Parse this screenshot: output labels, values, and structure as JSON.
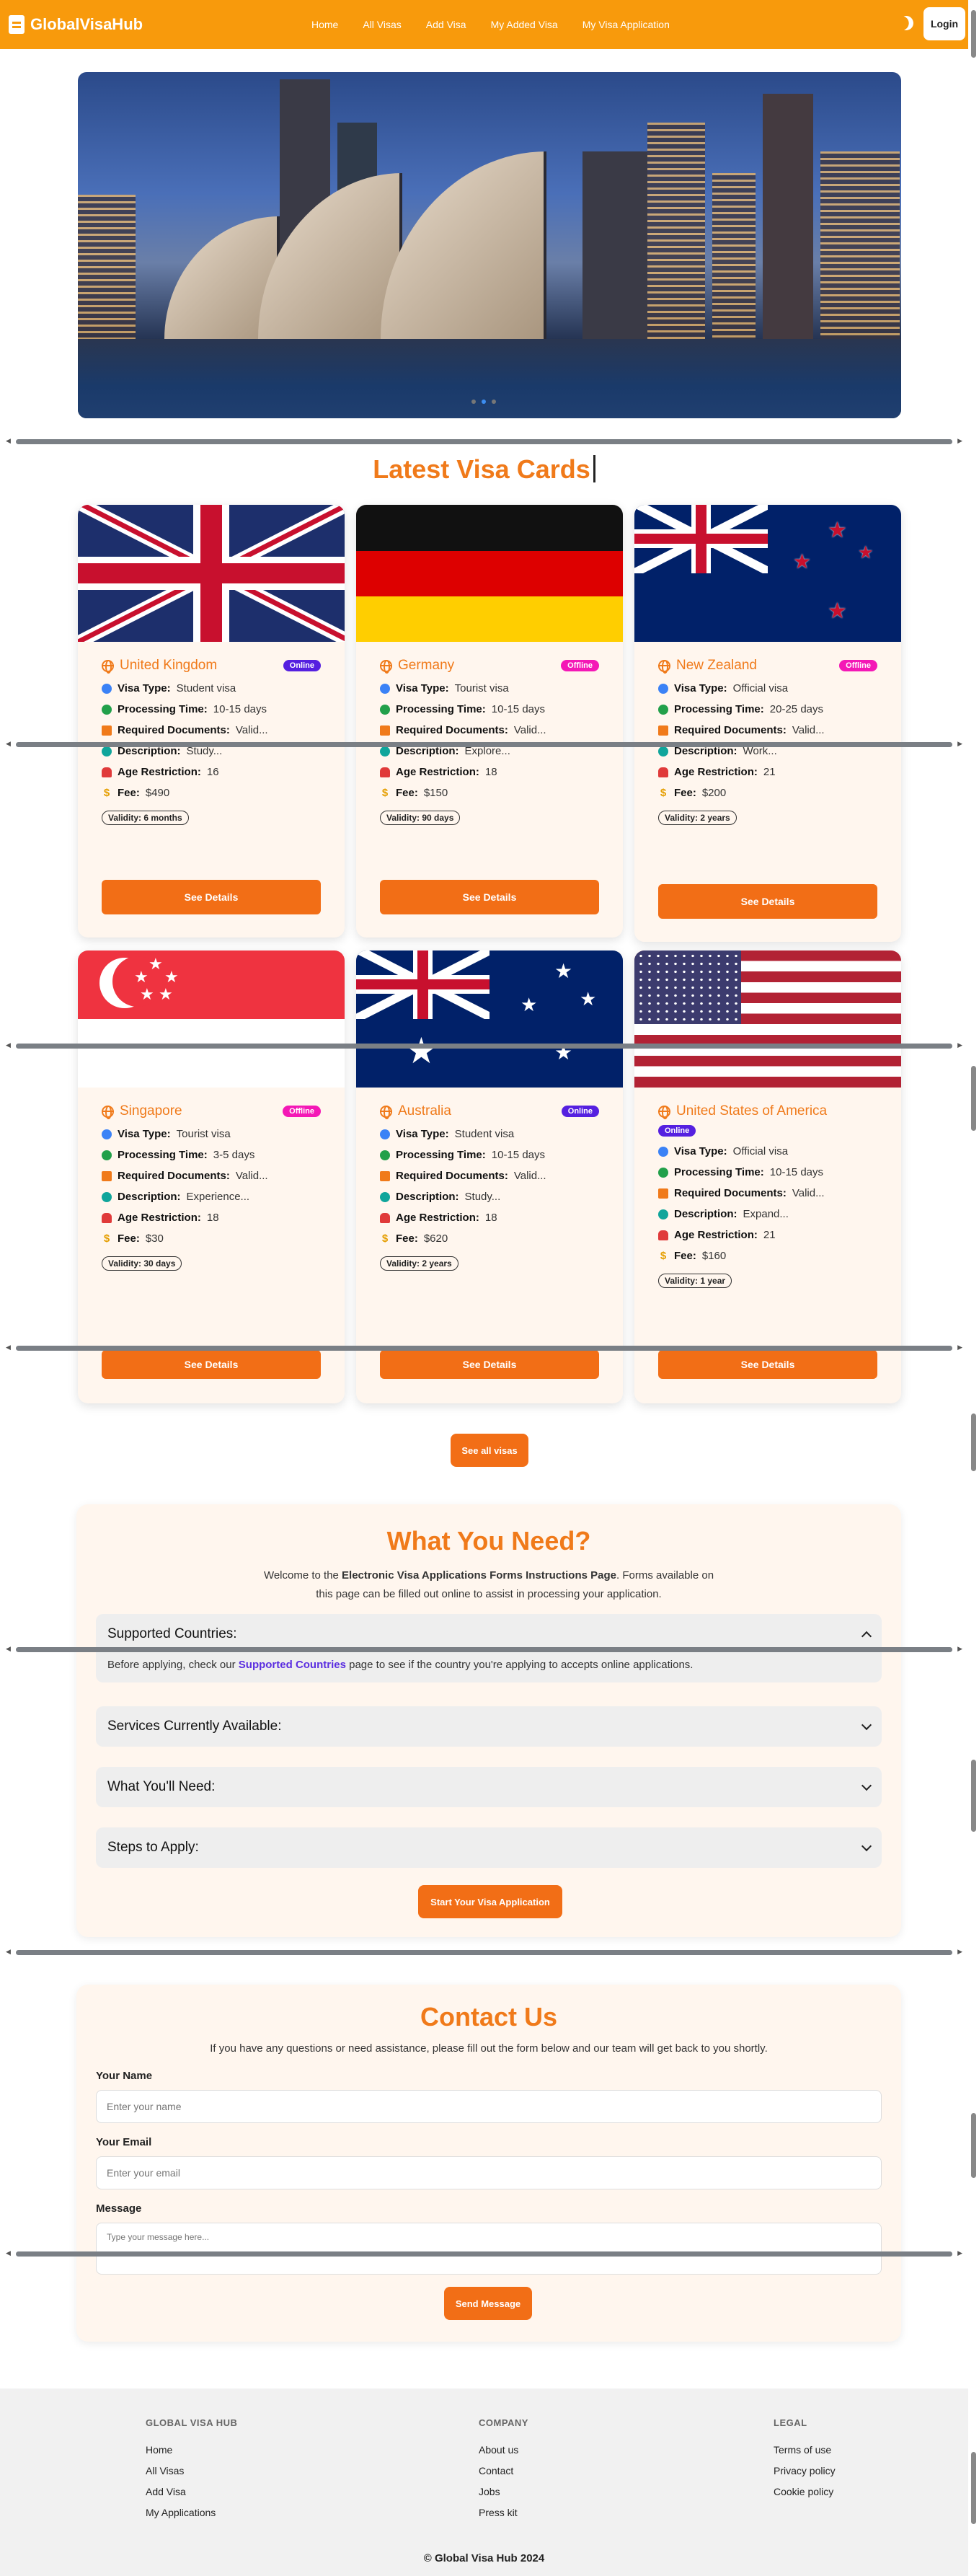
{
  "nav": {
    "brand": "GlobalVisaHub",
    "links": [
      "Home",
      "All Visas",
      "Add Visa",
      "My Added Visa",
      "My Visa Application"
    ],
    "login": "Login"
  },
  "latest": {
    "title": "Latest Visa Cards"
  },
  "labels": {
    "visa_type": "Visa Type:",
    "processing_time": "Processing Time:",
    "required_documents": "Required Documents:",
    "description": "Description:",
    "age_restriction": "Age Restriction:",
    "fee": "Fee:",
    "see_details": "See Details"
  },
  "cards": [
    {
      "country": "United Kingdom",
      "status": "Online",
      "visa_type": "Student visa",
      "processing": "10-15 days",
      "documents": "Valid...",
      "description": "Study...",
      "age": "16",
      "fee": "$490",
      "validity": "Validity: 6 months"
    },
    {
      "country": "Germany",
      "status": "Offline",
      "visa_type": "Tourist visa",
      "processing": "10-15 days",
      "documents": "Valid...",
      "description": "Explore...",
      "age": "18",
      "fee": "$150",
      "validity": "Validity: 90 days"
    },
    {
      "country": "New Zealand",
      "status": "Offline",
      "visa_type": "Official visa",
      "processing": "20-25 days",
      "documents": "Valid...",
      "description": "Work...",
      "age": "21",
      "fee": "$200",
      "validity": "Validity: 2 years"
    },
    {
      "country": "Singapore",
      "status": "Offline",
      "visa_type": "Tourist visa",
      "processing": "3-5 days",
      "documents": "Valid...",
      "description": "Experience...",
      "age": "18",
      "fee": "$30",
      "validity": "Validity: 30 days"
    },
    {
      "country": "Australia",
      "status": "Online",
      "visa_type": "Student visa",
      "processing": "10-15 days",
      "documents": "Valid...",
      "description": "Study...",
      "age": "18",
      "fee": "$620",
      "validity": "Validity: 2 years"
    },
    {
      "country": "United States of America",
      "status": "Online",
      "visa_type": "Official visa",
      "processing": "10-15 days",
      "documents": "Valid...",
      "description": "Expand...",
      "age": "21",
      "fee": "$160",
      "validity": "Validity: 1 year"
    }
  ],
  "see_all": "See all visas",
  "need": {
    "title": "What You Need?",
    "intro_pre": "Welcome to the ",
    "intro_bold": "Electronic Visa Applications Forms Instructions Page",
    "intro_post": ". Forms available on this page can be filled out online to assist in processing your application.",
    "accordion": [
      {
        "title": "Supported Countries:",
        "open": true,
        "body_pre": "Before applying, check our ",
        "body_link": "Supported Countries",
        "body_post": " page to see if the country you're applying to accepts online applications."
      },
      {
        "title": "Services Currently Available:",
        "open": false
      },
      {
        "title": "What You'll Need:",
        "open": false
      },
      {
        "title": "Steps to Apply:",
        "open": false
      }
    ],
    "apply_button": "Start Your Visa Application"
  },
  "contact": {
    "title": "Contact Us",
    "intro": "If you have any questions or need assistance, please fill out the form below and our team will get back to you shortly.",
    "name_label": "Your Name",
    "name_placeholder": "Enter your name",
    "email_label": "Your Email",
    "email_placeholder": "Enter your email",
    "message_label": "Message",
    "message_placeholder": "Type your message here...",
    "send": "Send Message"
  },
  "footer": {
    "cols": [
      {
        "heading": "GLOBAL VISA HUB",
        "links": [
          "Home",
          "All Visas",
          "Add Visa",
          "My Applications"
        ]
      },
      {
        "heading": "COMPANY",
        "links": [
          "About us",
          "Contact",
          "Jobs",
          "Press kit"
        ]
      },
      {
        "heading": "LEGAL",
        "links": [
          "Terms of use",
          "Privacy policy",
          "Cookie policy"
        ]
      }
    ],
    "copyright": "© Global Visa Hub 2024"
  },
  "colors": {
    "primary": "#f89a0c",
    "accent": "#f26e16",
    "online": "#5520e0",
    "offline": "#f418b6"
  }
}
